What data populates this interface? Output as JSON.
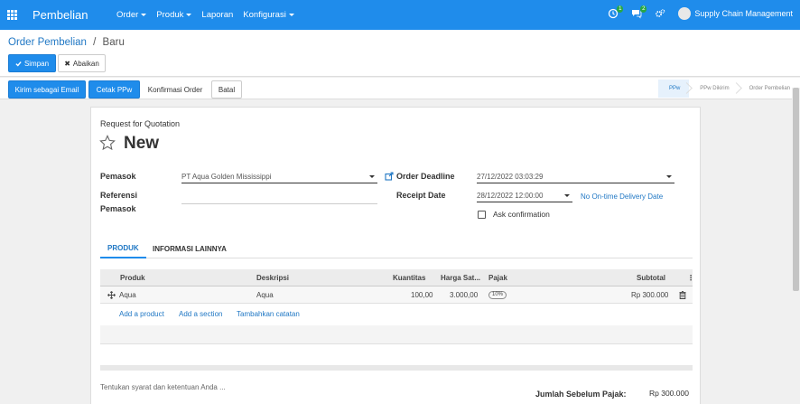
{
  "navbar": {
    "brand": "Pembelian",
    "menu": [
      {
        "label": "Order",
        "dropdown": true
      },
      {
        "label": "Produk",
        "dropdown": true
      },
      {
        "label": "Laporan",
        "dropdown": false
      },
      {
        "label": "Konfigurasi",
        "dropdown": true
      }
    ],
    "activity_count": "1",
    "messages_count": "2",
    "user": "Supply Chain Management"
  },
  "breadcrumb": {
    "parent": "Order Pembelian",
    "separator": "/",
    "current": "Baru"
  },
  "actions": {
    "save": "Simpan",
    "discard": "Abaikan"
  },
  "header_buttons": {
    "send_email": "Kirim sebagai Email",
    "print": "Cetak PPw",
    "confirm": "Konfirmasi Order",
    "cancel": "Batal"
  },
  "status_stages": [
    {
      "label": "PPw",
      "active": true
    },
    {
      "label": "PPw Dikirim",
      "active": false
    },
    {
      "label": "Order Pembelian",
      "active": false
    }
  ],
  "form": {
    "kicker": "Request for Quotation",
    "title": "New",
    "vendor_label": "Pemasok",
    "vendor_value": "PT Aqua Golden Mississippi",
    "vendor_ref_label_1": "Referensi",
    "vendor_ref_label_2": "Pemasok",
    "vendor_ref_value": "",
    "order_deadline_label": "Order Deadline",
    "order_deadline_value": "27/12/2022 03:03:29",
    "receipt_date_label": "Receipt Date",
    "receipt_date_value": "28/12/2022 12:00:00",
    "receipt_status": "No On-time Delivery Date",
    "ask_confirmation_label": "Ask confirmation",
    "ask_confirmation_checked": false
  },
  "tabs": [
    {
      "label": "PRODUK",
      "active": true
    },
    {
      "label": "INFORMASI LAINNYA",
      "active": false
    }
  ],
  "lines": {
    "headers": [
      "Produk",
      "Deskripsi",
      "Kuantitas",
      "Harga Sat...",
      "Pajak",
      "Subtotal"
    ],
    "rows": [
      {
        "product": "Aqua",
        "description": "Aqua",
        "quantity": "100,00",
        "unit_price": "3.000,00",
        "tax": "10%",
        "subtotal": "Rp 300.000"
      }
    ],
    "add_product": "Add a product",
    "add_section": "Add a section",
    "add_note": "Tambahkan catatan"
  },
  "notes_placeholder": "Tentukan syarat dan ketentuan Anda ...",
  "totals": {
    "untaxed_label": "Jumlah Sebelum Pajak:",
    "untaxed_value": "Rp 300.000"
  },
  "colors": {
    "primary": "#1f8ceb",
    "link": "#1f77c4"
  }
}
